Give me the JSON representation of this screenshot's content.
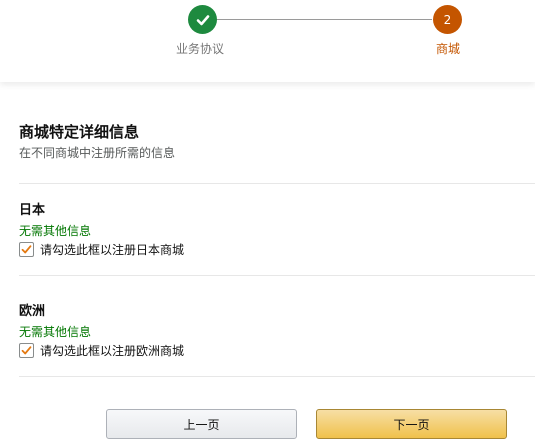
{
  "stepper": {
    "step1": {
      "label": "业务协议",
      "state": "completed",
      "icon": "checkmark-icon",
      "color": "#1e8a3f"
    },
    "step2": {
      "number": "2",
      "label": "商城",
      "state": "current",
      "color": "#c45500"
    }
  },
  "section": {
    "title": "商城特定详细信息",
    "subtitle": "在不同商城中注册所需的信息"
  },
  "regions": [
    {
      "name": "日本",
      "note": "无需其他信息",
      "checkbox_label": "请勾选此框以注册日本商城",
      "checked": true
    },
    {
      "name": "欧洲",
      "note": "无需其他信息",
      "checkbox_label": "请勾选此框以注册欧洲商城",
      "checked": true
    }
  ],
  "buttons": {
    "prev_label": "上一页",
    "next_label": "下一页"
  },
  "colors": {
    "success": "#007600",
    "accent": "#c45500",
    "checkmark": "#e47911",
    "primary_button": "#f0c14b"
  }
}
